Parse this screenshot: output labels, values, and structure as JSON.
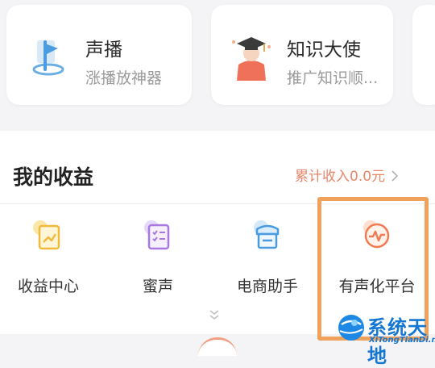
{
  "cards": [
    {
      "title": "声播",
      "subtitle": "涨播放神器",
      "icon": "flag-pin-icon"
    },
    {
      "title": "知识大使",
      "subtitle": "推广知识顺...",
      "icon": "graduate-avatar-icon"
    }
  ],
  "earnings": {
    "title": "我的收益",
    "cumulative_link": "累计收入0.0元",
    "items": [
      {
        "label": "收益中心",
        "icon": "chart-doc-icon"
      },
      {
        "label": "蜜声",
        "icon": "checklist-icon"
      },
      {
        "label": "电商助手",
        "icon": "shop-icon"
      },
      {
        "label": "有声化平台",
        "icon": "audio-wave-icon"
      }
    ]
  },
  "watermark": {
    "name": "系统天地",
    "url": "XiTongTianDi.net"
  },
  "colors": {
    "accent_orange": "#f0a15c",
    "link": "#e6866a",
    "watermark_blue": "#1677d2"
  }
}
